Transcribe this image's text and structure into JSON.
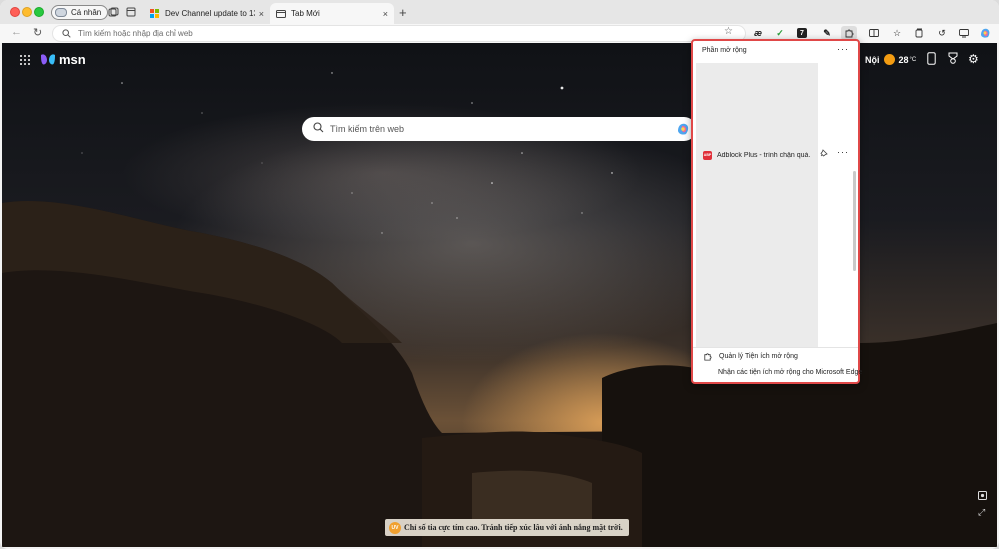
{
  "window": {
    "profile_label": "Cá nhân",
    "tabs": [
      {
        "title": "Dev Channel update to 132.0.2..",
        "close": "×",
        "favicon": "microsoft-logo-icon"
      },
      {
        "title": "Tab Mới",
        "close": "×",
        "favicon": "newtab-page-icon"
      }
    ],
    "new_tab": "+"
  },
  "toolbar": {
    "back": "←",
    "reload": "↻",
    "address_placeholder": "Tìm kiếm hoặc nhập địa chỉ web",
    "extension_glyphs": [
      "æ",
      "✓",
      "7",
      "✎"
    ]
  },
  "page": {
    "brand": "msn",
    "weather": {
      "city": "Nội",
      "temp": "28",
      "unit": "°C"
    },
    "search_placeholder": "Tìm kiếm trên web",
    "uv_badge": "UV",
    "uv_notice": "Chỉ số tia cực tím cao. Tránh tiếp xúc lâu với ánh nắng mặt trời."
  },
  "extensions_popup": {
    "title": "Phần mở rộng",
    "more": "···",
    "items": [
      {
        "icon_text": "ABP",
        "name": "Adblock Plus - trình chặn quả...",
        "row_more": "···"
      }
    ],
    "manage": "Quản lý Tiện ích mở rộng",
    "get": "Nhận các tiện ích mở rộng cho Microsoft Edge"
  },
  "colors": {
    "popup_border": "#e04848",
    "abp_red": "#e0303a",
    "sun": "#f39c12"
  }
}
